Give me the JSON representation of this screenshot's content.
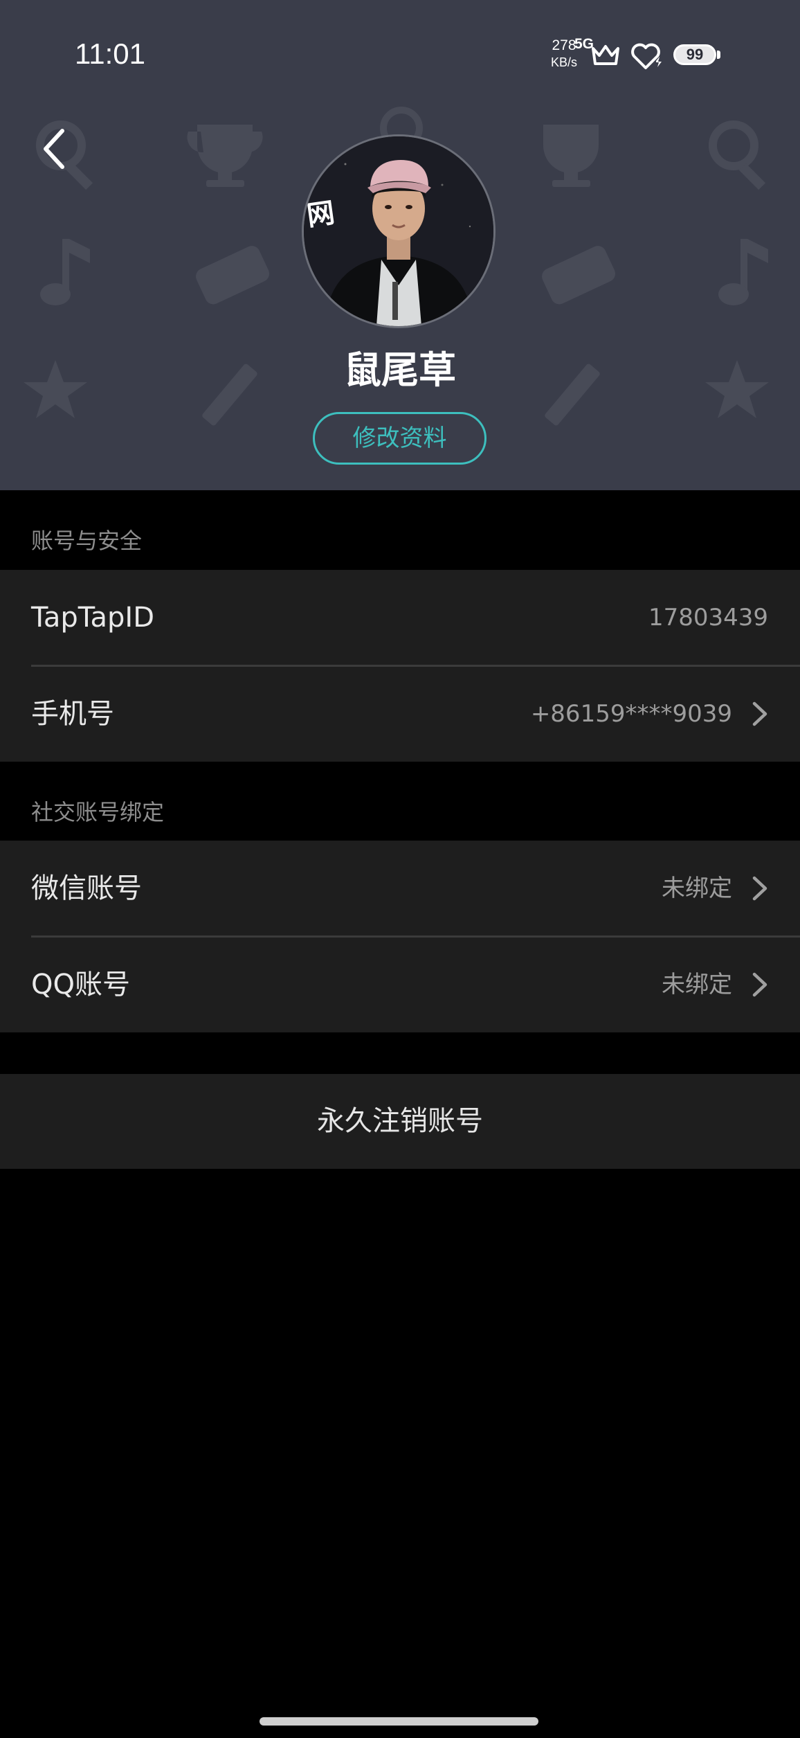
{
  "status_bar": {
    "time": "11:01",
    "net_speed_value": "278",
    "net_speed_unit": "KB/s",
    "signal": "5G",
    "battery": "99",
    "icons": [
      "crown-icon",
      "heart-shield-icon",
      "battery-icon"
    ]
  },
  "header": {
    "back_icon": "chevron-left-icon",
    "username": "鼠尾草",
    "avatar_caption": "网",
    "edit_label": "修改资料",
    "accent_color": "#3dbfbe",
    "background_color": "#3a3d4a"
  },
  "account_security": {
    "title": "账号与安全",
    "rows": [
      {
        "label": "TapTapID",
        "value": "17803439"
      },
      {
        "label": "手机号",
        "value": "+86159****9039"
      }
    ]
  },
  "social_binding": {
    "title": "社交账号绑定",
    "rows": [
      {
        "label": "微信账号",
        "value": "未绑定"
      },
      {
        "label": "QQ账号",
        "value": "未绑定"
      }
    ]
  },
  "delete_account": {
    "label": "永久注销账号"
  }
}
